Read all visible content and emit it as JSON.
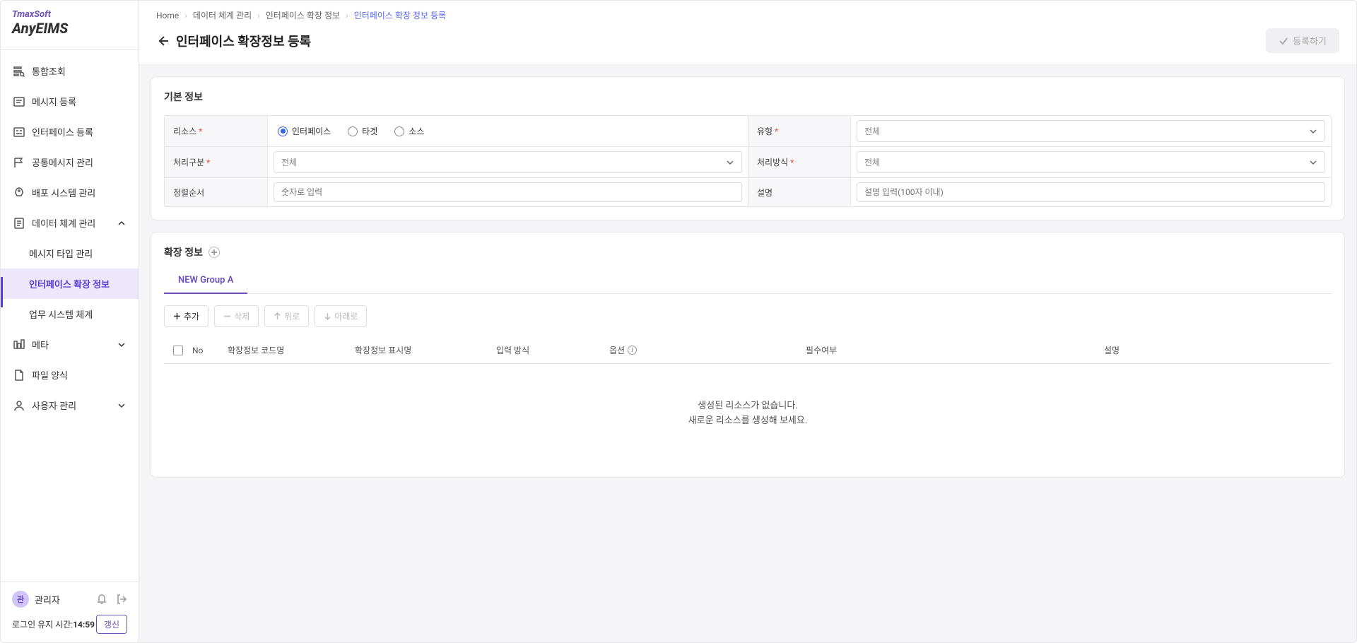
{
  "logo": {
    "brand": "TmaxSoft",
    "title": "AnyEIMS"
  },
  "nav": {
    "items": [
      {
        "label": "통합조회"
      },
      {
        "label": "메시지 등록"
      },
      {
        "label": "인터페이스 등록"
      },
      {
        "label": "공통메시지 관리"
      },
      {
        "label": "배포 시스템 관리"
      },
      {
        "label": "데이터 체계 관리"
      },
      {
        "label": "메타"
      },
      {
        "label": "파일 양식"
      },
      {
        "label": "사용자 관리"
      }
    ],
    "sub_data": [
      {
        "label": "메시지 타입 관리"
      },
      {
        "label": "인터페이스 확장 정보"
      },
      {
        "label": "업무 시스템 체계"
      }
    ]
  },
  "user": {
    "avatar_char": "관",
    "name": "관리자",
    "session_label": "로그인 유지 시간:",
    "session_time": "14:59",
    "refresh": "갱신"
  },
  "breadcrumb": {
    "items": [
      "Home",
      "데이터 체계 관리",
      "인터페이스 확장 정보",
      "인터페이스 확장 정보 등록"
    ]
  },
  "page": {
    "title": "인터페이스 확장정보 등록",
    "register_btn": "등록하기"
  },
  "basic_info": {
    "title": "기본 정보",
    "resource_label": "리소스",
    "radio_interface": "인터페이스",
    "radio_target": "타겟",
    "radio_source": "소스",
    "type_label": "유형",
    "type_value": "전체",
    "proc_class_label": "처리구분",
    "proc_class_value": "전체",
    "proc_method_label": "처리방식",
    "proc_method_value": "전체",
    "order_label": "정렬순서",
    "order_placeholder": "숫자로 입력",
    "desc_label": "설명",
    "desc_placeholder": "설명 입력(100자 이내)"
  },
  "ext_info": {
    "title": "확장 정보",
    "tab1": "NEW Group A",
    "btn_add": "추가",
    "btn_delete": "삭제",
    "btn_up": "위로",
    "btn_down": "아래로",
    "cols": {
      "no": "No",
      "code": "확장정보 코드명",
      "display": "확장정보 표시명",
      "input": "입력 방식",
      "option": "옵션",
      "required": "필수여부",
      "desc": "설명"
    },
    "empty1": "생성된 리소스가 없습니다.",
    "empty2": "새로운 리소스를 생성해 보세요."
  }
}
